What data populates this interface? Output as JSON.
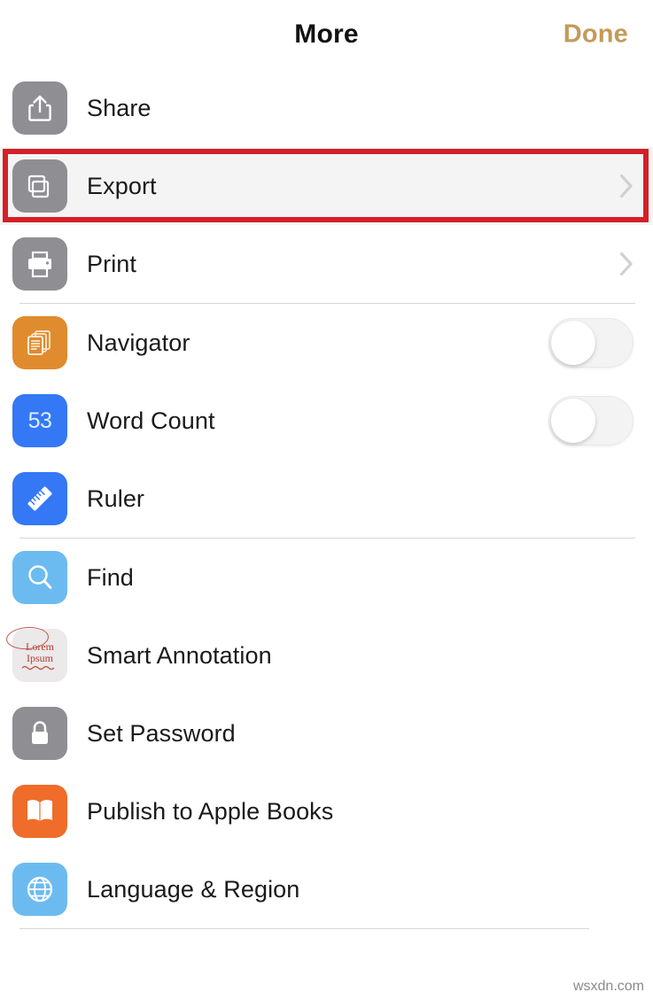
{
  "header": {
    "title": "More",
    "done_label": "Done"
  },
  "colors": {
    "done_accent": "#c49a5a",
    "annotation_red": "#d42027",
    "highlight_row_bg": "#f4f4f4",
    "icon_gray": "#8e8e93",
    "icon_orange": "#e08b2e",
    "icon_blue": "#3478f6",
    "icon_light_blue": "#6cbbf0",
    "icon_books_orange": "#ef6c2a",
    "separator": "#d6d6d6"
  },
  "groups": [
    {
      "name": "document-actions",
      "rows": [
        {
          "label": "Share",
          "icon": "share-icon",
          "icon_color": "#8e8e93",
          "accessory": "none",
          "highlighted": false
        },
        {
          "label": "Export",
          "icon": "export-icon",
          "icon_color": "#8e8e93",
          "accessory": "chevron",
          "highlighted": true
        },
        {
          "label": "Print",
          "icon": "print-icon",
          "icon_color": "#8e8e93",
          "accessory": "chevron",
          "highlighted": false
        }
      ]
    },
    {
      "name": "view-options",
      "rows": [
        {
          "label": "Navigator",
          "icon": "navigator-icon",
          "icon_color": "#e08b2e",
          "accessory": "toggle",
          "toggle_on": false,
          "highlighted": false
        },
        {
          "label": "Word Count",
          "icon": "word-count-icon",
          "icon_color": "#3478f6",
          "icon_badge": "53",
          "accessory": "toggle",
          "toggle_on": false,
          "highlighted": false
        },
        {
          "label": "Ruler",
          "icon": "ruler-icon",
          "icon_color": "#3478f6",
          "accessory": "none",
          "highlighted": false
        }
      ]
    },
    {
      "name": "tools",
      "rows": [
        {
          "label": "Find",
          "icon": "find-icon",
          "icon_color": "#6cbbf0",
          "accessory": "none",
          "highlighted": false
        },
        {
          "label": "Smart Annotation",
          "icon": "smart-annotation-icon",
          "icon_color": "#ebe9e9",
          "lorem_line1": "Lorem",
          "lorem_line2": "Ipsum",
          "accessory": "none",
          "highlighted": false
        },
        {
          "label": "Set Password",
          "icon": "lock-icon",
          "icon_color": "#8e8e93",
          "accessory": "none",
          "highlighted": false
        },
        {
          "label": "Publish to Apple Books",
          "icon": "book-icon",
          "icon_color": "#ef6c2a",
          "accessory": "none",
          "highlighted": false
        },
        {
          "label": "Language & Region",
          "icon": "globe-icon",
          "icon_color": "#6cbbf0",
          "accessory": "none",
          "highlighted": false
        }
      ]
    }
  ],
  "annotation": {
    "target_row_label": "Export",
    "shape": "rectangle"
  },
  "watermark": {
    "text": "wsxdn.com"
  }
}
